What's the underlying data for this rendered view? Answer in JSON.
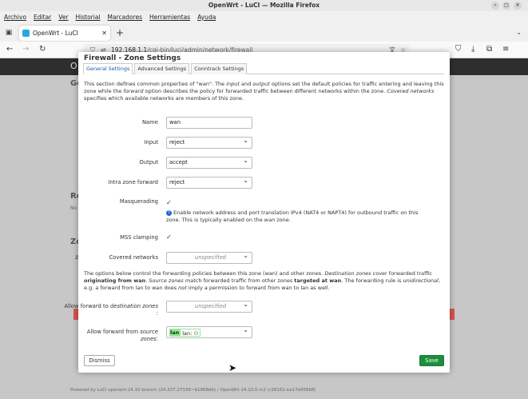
{
  "window": {
    "title": "OpenWrt - LuCI — Mozilla Firefox"
  },
  "menubar": [
    "Archivo",
    "Editar",
    "Ver",
    "Historial",
    "Marcadores",
    "Herramientas",
    "Ayuda"
  ],
  "browser": {
    "tab_title": "OpenWrt - LuCI",
    "url_host": "192.168.1.1",
    "url_path": "/cgi-bin/luci/admin/network/firewall"
  },
  "background_page": {
    "brand": "O",
    "heading_general": "Ge",
    "heading_routing": "Ro",
    "text_no": "No",
    "heading_zones": "Zo",
    "text_z": "Z",
    "footer": "Powered by LuCI openwrt-24.10 branch (24.337.27339~b1968db) / OpenWrt 24.10.0-rc2 (r28161-ea17e958b8)"
  },
  "modal": {
    "title": "Firewall - Zone Settings",
    "tabs": [
      "General Settings",
      "Advanced Settings",
      "Conntrack Settings"
    ],
    "desc": {
      "p1": "This section defines common properties of \"wan\". The ",
      "input_word": "input",
      "p2": " and ",
      "output_word": "output",
      "p3": " options set the default policies for traffic entering and leaving this zone while the ",
      "forward_word": "forward",
      "p4": " option describes the policy for forwarded traffic between different networks within the zone. ",
      "covered": "Covered networks",
      "p5": " specifies which available networks are members of this zone."
    },
    "fields": {
      "name_label": "Name",
      "name_value": "wan",
      "input_label": "Input",
      "input_value": "reject",
      "output_label": "Output",
      "output_value": "accept",
      "intra_label": "Intra zone forward",
      "intra_value": "reject",
      "masq_label": "Masquerading",
      "masq_help_a": "Enable network address and port translation IPv4 (NAT4 or NAPT4) for outbound traffic on this zone. This is typically enabled on the ",
      "masq_help_zone": "wan",
      "masq_help_b": " zone.",
      "mss_label": "MSS clamping",
      "covered_label": "Covered networks",
      "covered_value": "unspecified"
    },
    "forward_desc": {
      "a": "The options below control the forwarding policies between this zone (wan) and other zones. ",
      "dest": "Destination zones",
      "b": " cover forwarded traffic ",
      "orig": "originating from wan",
      "c": ". ",
      "source": "Source zones",
      "d": " match forwarded traffic from other zones ",
      "targeted": "targeted at wan",
      "e": ". The forwarding rule is ",
      "unidir": "unidirectional",
      "f": ", e.g. a forward from lan to wan does ",
      "not": "not",
      "g": " imply a permission to forward from wan to lan as well."
    },
    "allow_dest": {
      "label_a": "Allow forward to ",
      "label_b": "destination zones",
      "label_c": ":",
      "value": "unspecified"
    },
    "allow_src": {
      "label_a": "Allow forward from ",
      "label_b": "source",
      "label_c": "zones",
      "label_d": ":",
      "chip": "lan",
      "chip_sub": "lan:"
    },
    "buttons": {
      "dismiss": "Dismiss",
      "save": "Save"
    }
  },
  "colors": {
    "save": "#1d8f3c",
    "chip": "#90ee90",
    "link_tab": "#1a5aa8"
  }
}
